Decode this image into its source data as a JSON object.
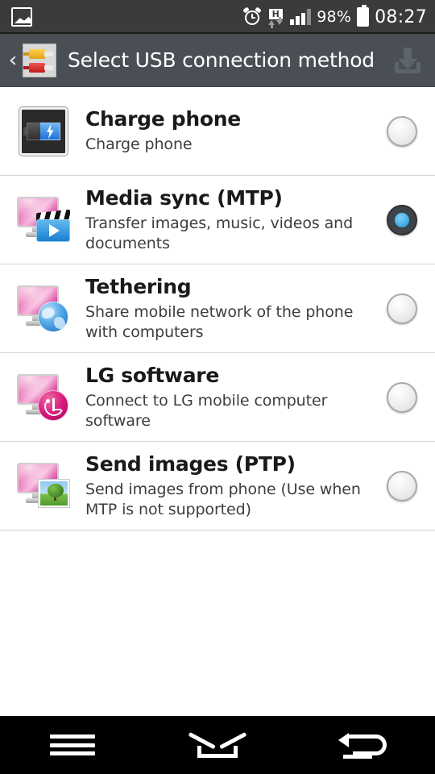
{
  "status_bar": {
    "left_icon": "gallery-icon",
    "alarm_icon": "alarm-clock-icon",
    "network_type": "H",
    "battery_percent": "98%",
    "time": "08:27"
  },
  "header": {
    "back_label": "‹",
    "app_icon": "usb-cable-icon",
    "title": "Select USB connection method",
    "action_icon": "download-icon"
  },
  "options": [
    {
      "icon": "charge-battery-icon",
      "title": "Charge phone",
      "subtitle": "Charge phone",
      "selected": false
    },
    {
      "icon": "media-sync-icon",
      "title": "Media sync (MTP)",
      "subtitle": "Transfer images, music, videos and documents",
      "selected": true
    },
    {
      "icon": "tethering-globe-icon",
      "title": "Tethering",
      "subtitle": "Share mobile network of the phone with computers",
      "selected": false
    },
    {
      "icon": "lg-software-icon",
      "title": "LG software",
      "subtitle": "Connect to LG mobile computer software",
      "selected": false
    },
    {
      "icon": "send-images-icon",
      "title": "Send images (PTP)",
      "subtitle": "Send images from phone (Use when MTP is not supported)",
      "selected": false
    }
  ],
  "navbar": {
    "menu": "menu-icon",
    "home": "home-icon",
    "back": "back-icon"
  },
  "colors": {
    "status_bar_bg": "#3b3b3b",
    "header_bg": "#4a4f56",
    "accent_selected": "#38a8e0",
    "list_bg": "#ffffff",
    "divider": "#d3d3d3",
    "navbar_bg": "#000000"
  }
}
